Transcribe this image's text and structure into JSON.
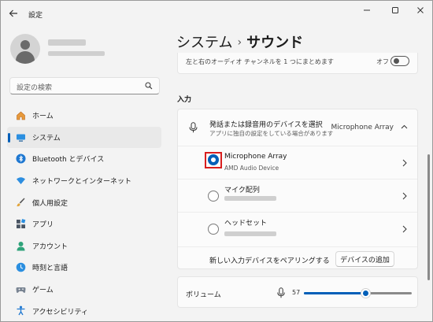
{
  "window": {
    "title": "設定",
    "controls": [
      "minimize-icon",
      "maximize-icon",
      "close-icon"
    ]
  },
  "sidebar": {
    "search_placeholder": "設定の検索",
    "items": [
      {
        "label": "ホーム",
        "icon": "home-icon",
        "active": false
      },
      {
        "label": "システム",
        "icon": "system-icon",
        "active": true
      },
      {
        "label": "Bluetooth とデバイス",
        "icon": "bluetooth-icon",
        "active": false
      },
      {
        "label": "ネットワークとインターネット",
        "icon": "network-icon",
        "active": false
      },
      {
        "label": "個人用設定",
        "icon": "personalization-icon",
        "active": false
      },
      {
        "label": "アプリ",
        "icon": "apps-icon",
        "active": false
      },
      {
        "label": "アカウント",
        "icon": "account-icon",
        "active": false
      },
      {
        "label": "時刻と言語",
        "icon": "time-language-icon",
        "active": false
      },
      {
        "label": "ゲーム",
        "icon": "gaming-icon",
        "active": false
      },
      {
        "label": "アクセシビリティ",
        "icon": "accessibility-icon",
        "active": false
      }
    ]
  },
  "main": {
    "breadcrumb": {
      "parent": "システム",
      "separator": "›",
      "current": "サウンド"
    },
    "top_card": {
      "text": "左と右のオーディオ チャンネルを 1 つにまとめます",
      "toggle_label": "オフ"
    },
    "input_section": {
      "heading": "入力",
      "header_title": "発話または録音用のデバイスを選択",
      "header_subtitle": "アプリに独自の設定をしている場合があります",
      "selected_device": "Microphone Array",
      "devices": [
        {
          "name": "Microphone Array",
          "sub": "AMD Audio Device",
          "checked": true
        },
        {
          "name": "マイク配列",
          "sub": "",
          "checked": false
        },
        {
          "name": "ヘッドセット",
          "sub": "",
          "checked": false
        }
      ],
      "pair_text": "新しい入力デバイスをペアリングする",
      "add_button": "デバイスの追加"
    },
    "volume": {
      "label": "ボリューム",
      "value": "57",
      "percent": 57
    }
  },
  "colors": {
    "accent": "#005fb8",
    "highlight": "#d81e1e",
    "background": "#f3f3f3"
  }
}
